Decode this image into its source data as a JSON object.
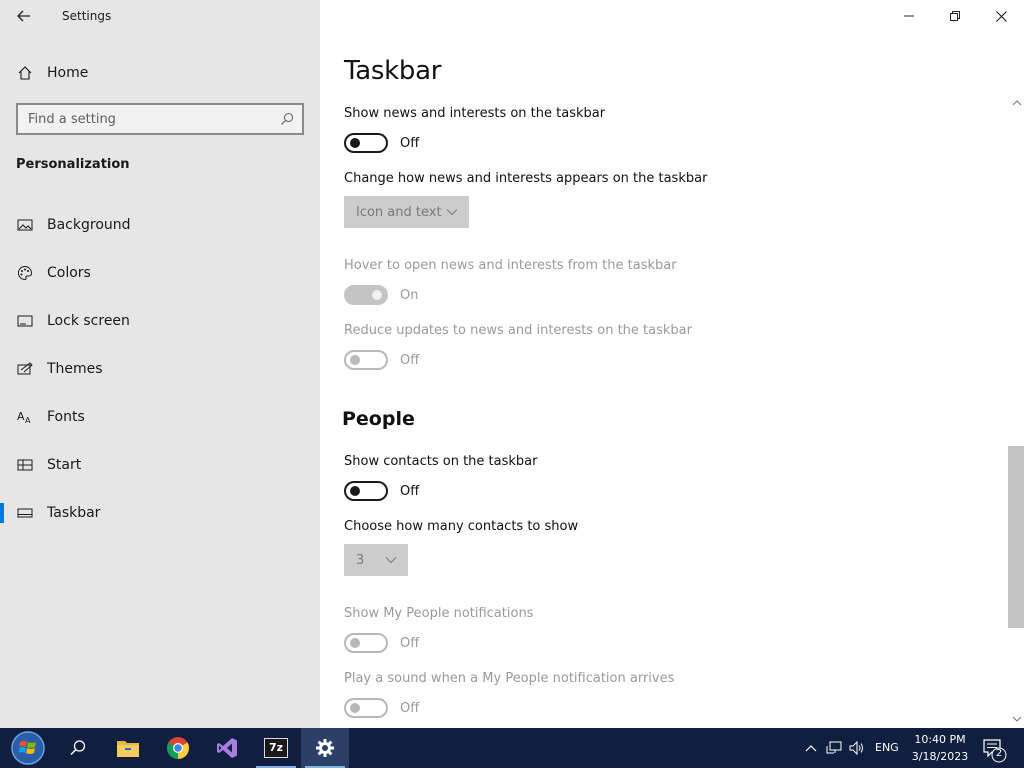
{
  "window": {
    "title": "Settings"
  },
  "sidebar": {
    "home_label": "Home",
    "search_placeholder": "Find a setting",
    "section_title": "Personalization",
    "items": [
      {
        "label": "Background",
        "icon": "picture-icon"
      },
      {
        "label": "Colors",
        "icon": "palette-icon"
      },
      {
        "label": "Lock screen",
        "icon": "lock-screen-icon"
      },
      {
        "label": "Themes",
        "icon": "themes-icon"
      },
      {
        "label": "Fonts",
        "icon": "fonts-icon"
      },
      {
        "label": "Start",
        "icon": "start-icon"
      },
      {
        "label": "Taskbar",
        "icon": "taskbar-icon",
        "selected": true
      }
    ]
  },
  "main": {
    "page_title": "Taskbar",
    "settings": {
      "news_show_label": "Show news and interests on the taskbar",
      "news_show_state": "Off",
      "news_appear_label": "Change how news and interests appears on the taskbar",
      "news_appear_value": "Icon and text",
      "news_hover_label": "Hover to open news and interests from the taskbar",
      "news_hover_state": "On",
      "news_reduce_label": "Reduce updates to news and interests on the taskbar",
      "news_reduce_state": "Off"
    },
    "people": {
      "heading": "People",
      "show_contacts_label": "Show contacts on the taskbar",
      "show_contacts_state": "Off",
      "contacts_count_label": "Choose how many contacts to show",
      "contacts_count_value": "3",
      "notifications_label": "Show My People notifications",
      "notifications_state": "Off",
      "sound_label": "Play a sound when a My People notification arrives",
      "sound_state": "Off"
    }
  },
  "taskbar": {
    "apps": [
      {
        "name": "start-button"
      },
      {
        "name": "search-icon"
      },
      {
        "name": "file-explorer-icon"
      },
      {
        "name": "chrome-icon"
      },
      {
        "name": "visual-studio-icon"
      },
      {
        "name": "7zip-icon",
        "text": "7z"
      },
      {
        "name": "settings-icon"
      }
    ],
    "tray": {
      "language": "ENG",
      "time": "10:40 PM",
      "date": "3/18/2023",
      "notification_count": "2"
    }
  },
  "colors": {
    "accent": "#0078d7",
    "sidebar_bg": "#e6e6e6",
    "taskbar_bg": "#101f3f"
  }
}
